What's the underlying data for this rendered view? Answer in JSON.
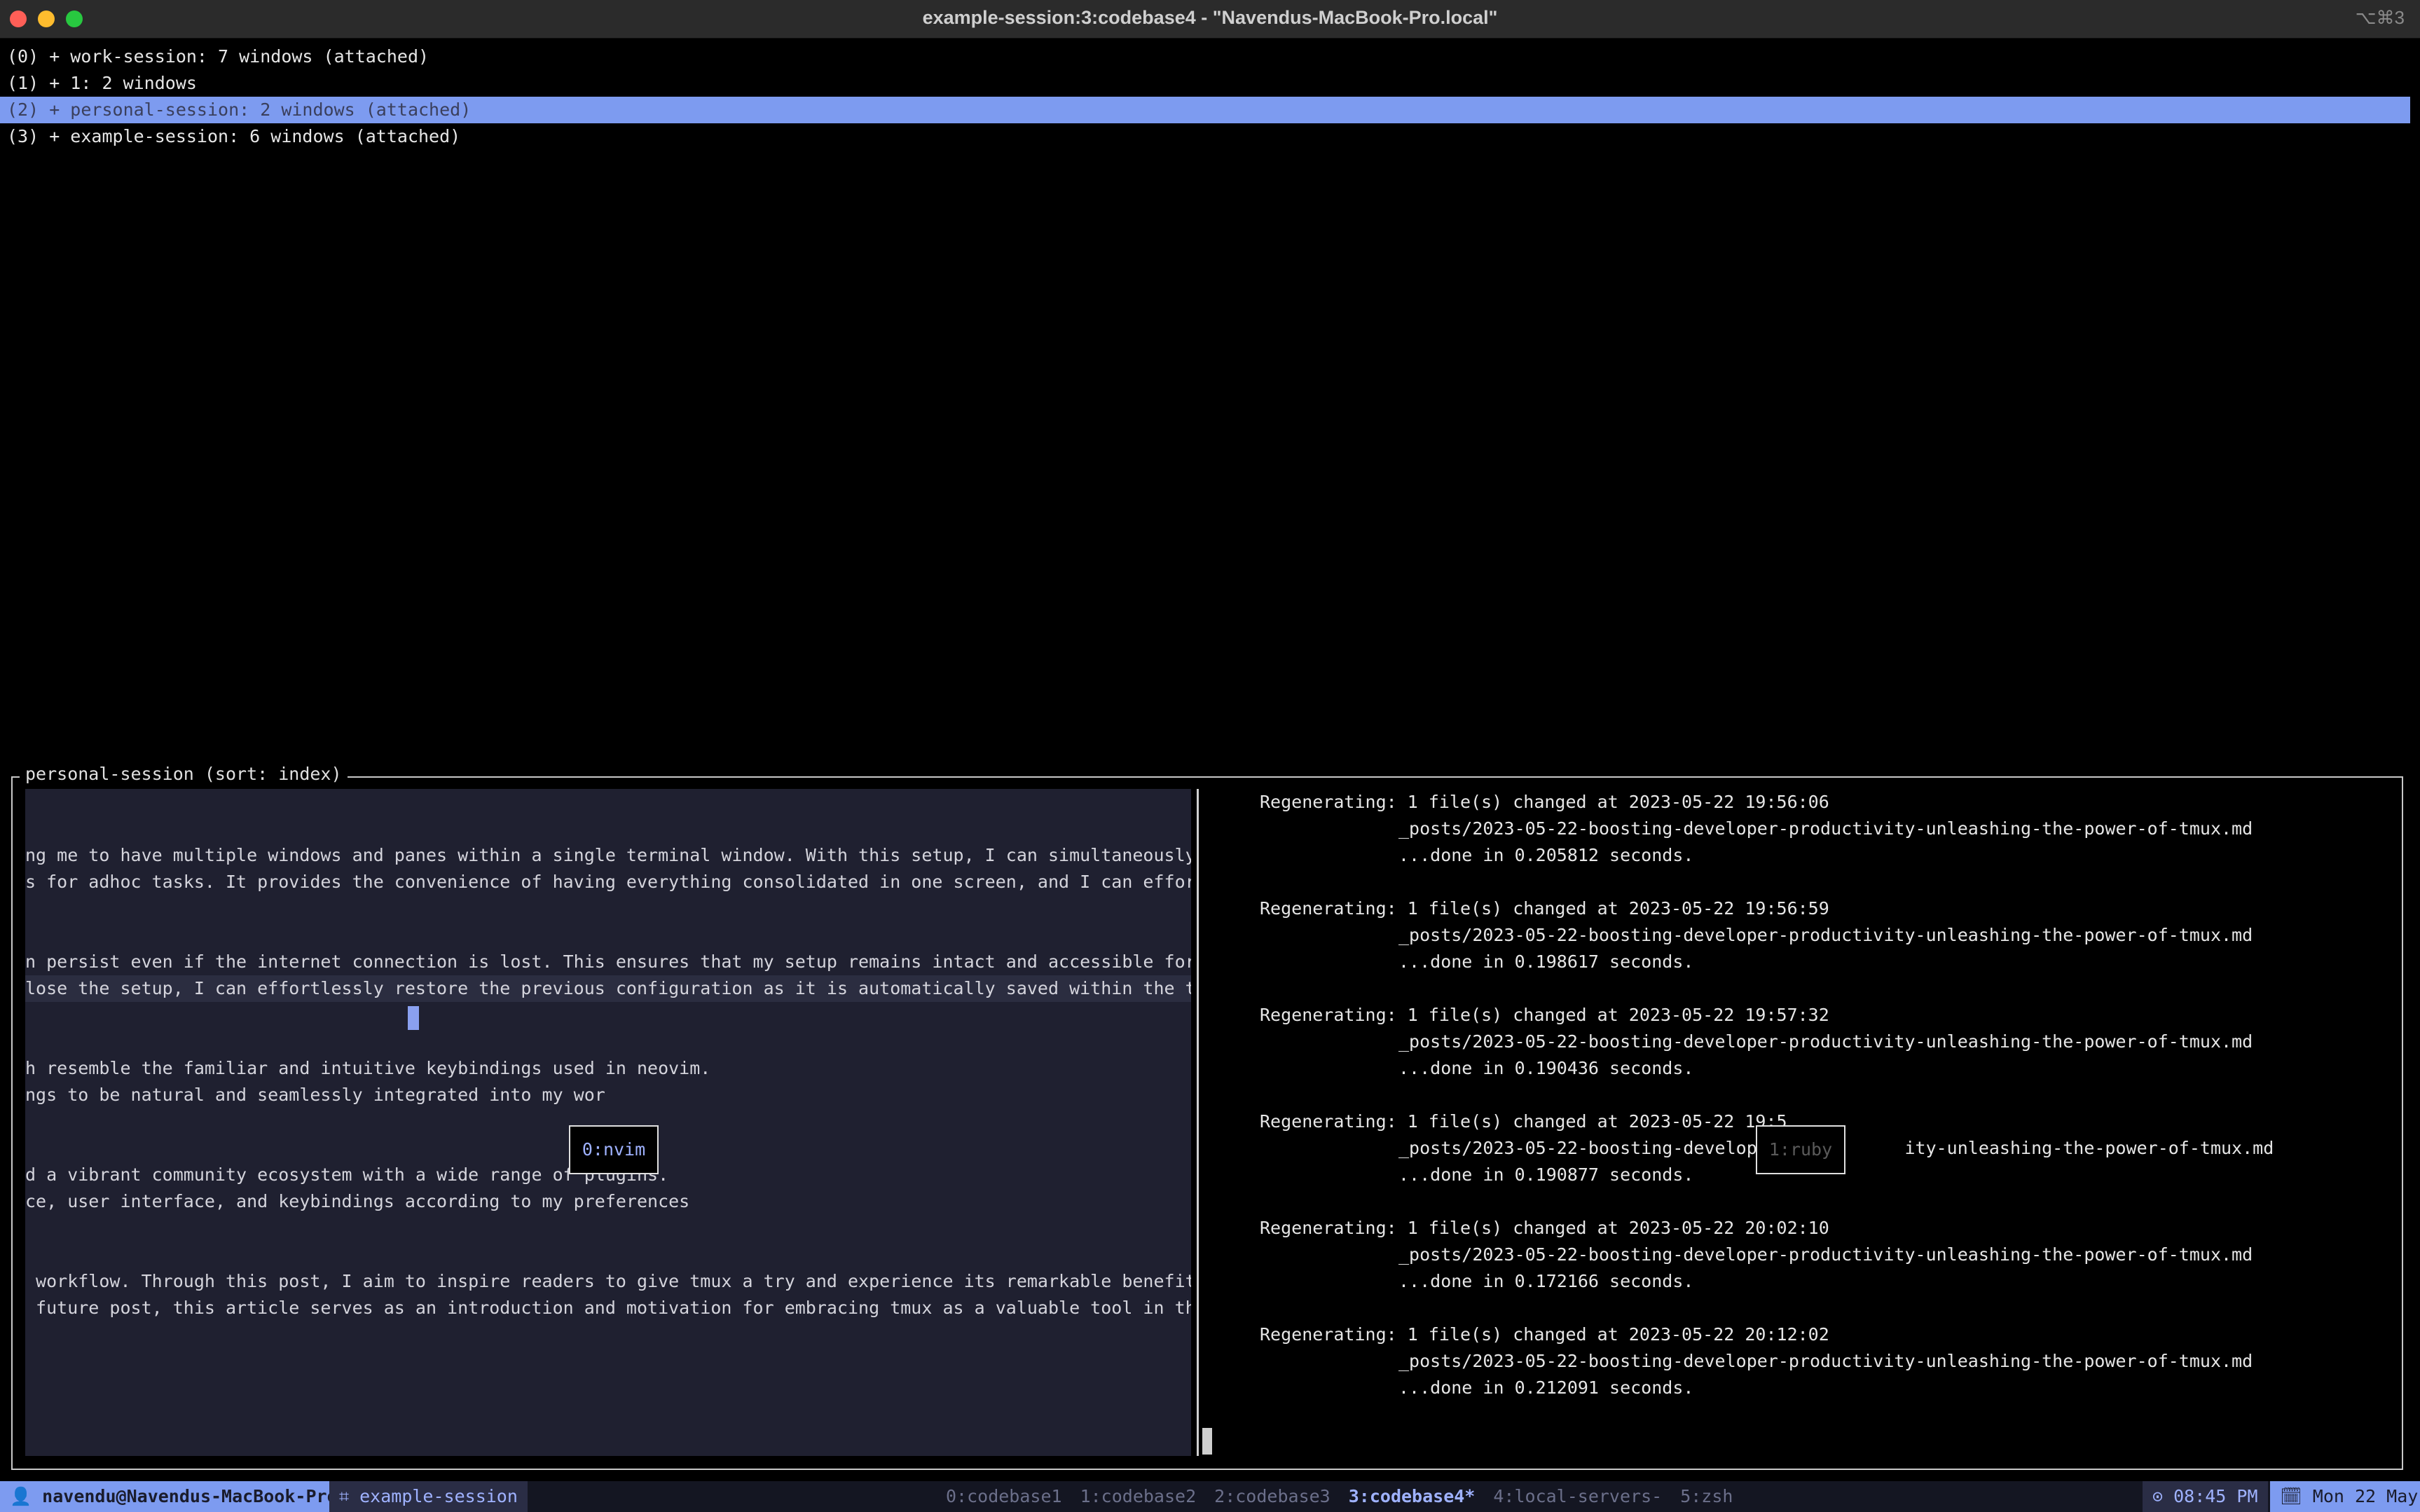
{
  "window": {
    "title": "example-session:3:codebase4 - \"Navendus-MacBook-Pro.local\"",
    "shortcut": "⌥⌘3"
  },
  "sessions": [
    {
      "text": "(0) + work-session: 7 windows (attached)",
      "selected": false
    },
    {
      "text": "(1) + 1: 2 windows",
      "selected": false
    },
    {
      "text": "(2) + personal-session: 2 windows (attached)",
      "selected": true
    },
    {
      "text": "(3) + example-session: 6 windows (attached)",
      "selected": false
    }
  ],
  "preview": {
    "label": "personal-session (sort: index)",
    "left_lines": [
      "ng me to have multiple windows and panes within a single terminal window. With this setup, I can simultaneously access",
      "s for adhoc tasks. It provides the convenience of having everything consolidated in one screen, and I can effortlessly",
      "",
      "",
      "n persist even if the internet connection is lost. This ensures that my setup remains intact and accessible for an exte",
      "lose the setup, I can effortlessly restore the previous configuration as it is automatically saved within the tmux sess",
      "",
      "",
      "h resemble the familiar and intuitive keybindings used in neovim.",
      "ngs to be natural and seamlessly integrated into my wor",
      "",
      "",
      "d a vibrant community ecosystem with a wide range of plugins.",
      "ce, user interface, and keybindings according to my preferences",
      "",
      "",
      " workflow. Through this post, I aim to inspire readers to give tmux a try and experience its remarkable benefits.",
      " future post, this article serves as an introduction and motivation for embracing tmux as a valuable tool in their own"
    ],
    "log_entries": [
      {
        "line1": "Regenerating: 1 file(s) changed at 2023-05-22 19:56:06",
        "line2": "_posts/2023-05-22-boosting-developer-productivity-unleashing-the-power-of-tmux.md",
        "line3": "...done in 0.205812 seconds."
      },
      {
        "line1": "Regenerating: 1 file(s) changed at 2023-05-22 19:56:59",
        "line2": "_posts/2023-05-22-boosting-developer-productivity-unleashing-the-power-of-tmux.md",
        "line3": "...done in 0.198617 seconds."
      },
      {
        "line1": "Regenerating: 1 file(s) changed at 2023-05-22 19:57:32",
        "line2": "_posts/2023-05-22-boosting-developer-productivity-unleashing-the-power-of-tmux.md",
        "line3": "...done in 0.190436 seconds."
      },
      {
        "line1": "Regenerating: 1 file(s) changed at 2023-05-22 19:5",
        "line2": "_posts/2023-05-22-boosting-developer            ity-unleashing-the-power-of-tmux.md",
        "line3": "...done in 0.190877 seconds."
      },
      {
        "line1": "Regenerating: 1 file(s) changed at 2023-05-22 20:02:10",
        "line2": "_posts/2023-05-22-boosting-developer-productivity-unleashing-the-power-of-tmux.md",
        "line3": "...done in 0.172166 seconds."
      },
      {
        "line1": "Regenerating: 1 file(s) changed at 2023-05-22 20:12:02",
        "line2": "_posts/2023-05-22-boosting-developer-productivity-unleashing-the-power-of-tmux.md",
        "line3": "...done in 0.212091 seconds."
      }
    ],
    "pane_labels": {
      "left": "0:nvim",
      "right": "1:ruby"
    }
  },
  "statusbar": {
    "host": "👤 navendu@Navendus-MacBook-Pro",
    "session": "⌗ example-session",
    "windows": [
      {
        "label": "0:codebase1",
        "active": false
      },
      {
        "label": "1:codebase2",
        "active": false
      },
      {
        "label": "2:codebase3",
        "active": false
      },
      {
        "label": "3:codebase4*",
        "active": true
      },
      {
        "label": "4:local-servers-",
        "active": false
      },
      {
        "label": "5:zsh",
        "active": false
      }
    ],
    "time": "⊙ 08:45 PM",
    "date": "🗓 Mon 22 May"
  },
  "colors": {
    "accent": "#7d9bf0",
    "pane_bg": "#1f2030",
    "terminal_bg": "#000000"
  }
}
